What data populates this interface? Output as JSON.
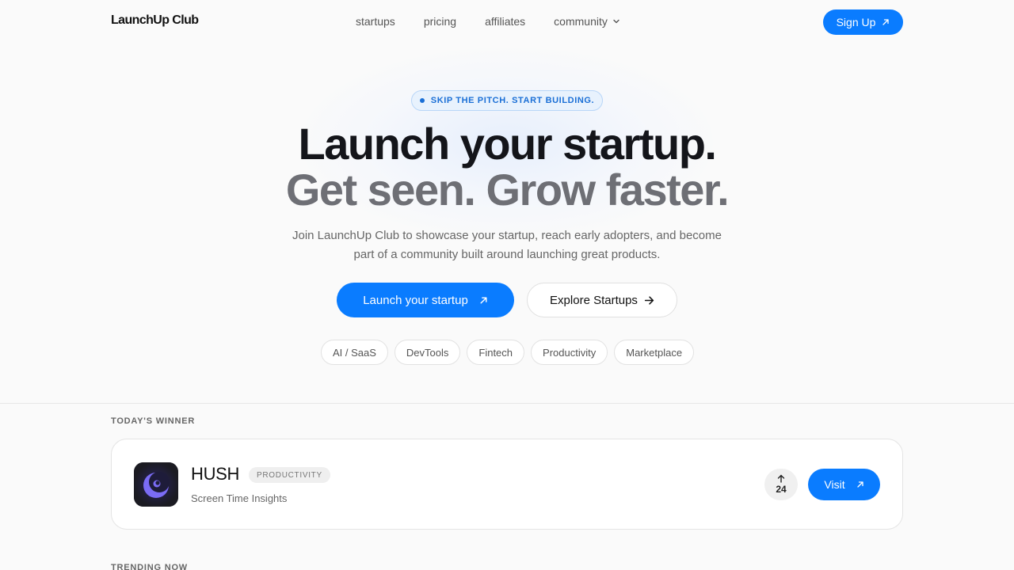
{
  "nav": {
    "logo": "LaunchUp Club",
    "links": [
      {
        "label": "startups"
      },
      {
        "label": "pricing"
      },
      {
        "label": "affiliates"
      },
      {
        "label": "community",
        "dropdown": true
      }
    ],
    "signup_label": "Sign Up"
  },
  "hero": {
    "badge": "SKIP THE PITCH. START BUILDING.",
    "title": "Launch your startup.",
    "subtitle": "Get seen. Grow faster.",
    "description": "Join LaunchUp Club to showcase your startup, reach early adopters, and become part of a community built around launching great products.",
    "primary_cta": "Launch your startup",
    "secondary_cta": "Explore Startups",
    "categories": [
      "AI / SaaS",
      "DevTools",
      "Fintech",
      "Productivity",
      "Marketplace"
    ]
  },
  "winner": {
    "section_label": "TODAY'S WINNER",
    "name": "HUSH",
    "tag": "PRODUCTIVITY",
    "tagline": "Screen Time Insights",
    "votes": "24",
    "visit_label": "Visit"
  },
  "trending": {
    "section_label": "TRENDING NOW"
  },
  "colors": {
    "accent": "#0a7cff",
    "badge_text": "#1a6fd6",
    "title": "#14151a",
    "subtitle": "#6e6f75"
  },
  "icons": [
    "arrow-up-right-icon",
    "arrow-right-icon",
    "chevron-down-icon",
    "arrow-up-icon",
    "hush-app-icon"
  ]
}
